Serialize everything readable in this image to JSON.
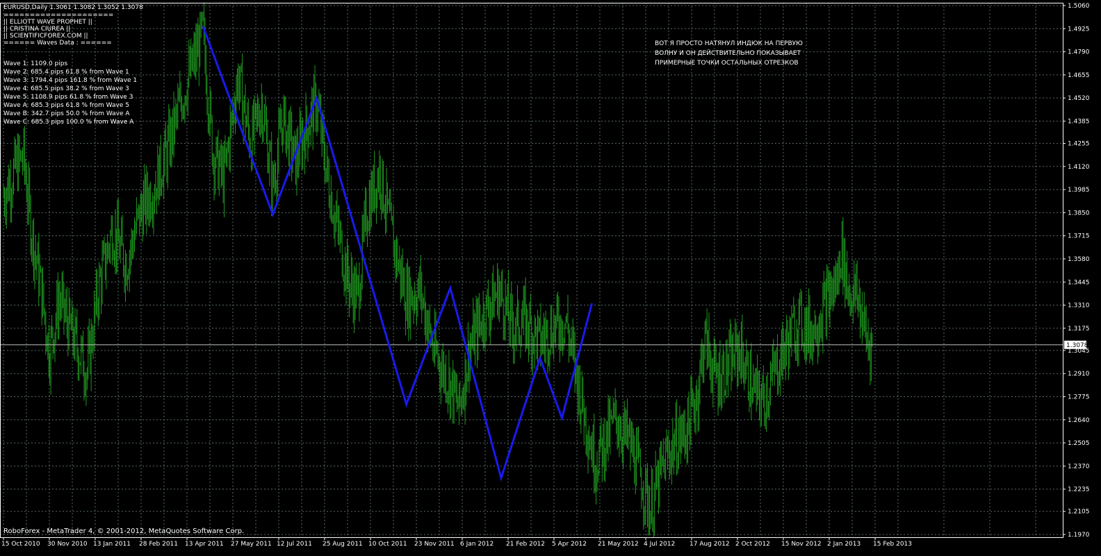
{
  "chart_header": "EURUSD,Daily  1.3061 1.3082 1.3052 1.3078",
  "indicator_box": [
    "=====================",
    "||   ELLIOTT WAVE PROPHET   ||",
    "||      CRISTINA CIUREA       ||",
    "||   SCIENTIFICFOREX.COM   ||",
    "====== Waves Data : ======"
  ],
  "wave_stats": [
    "Wave 1: 1109.0 pips",
    "Wave 2: 685.4 pips 61.8 % from Wave 1",
    "Wave 3: 1794.4 pips 161.8 % from Wave 1",
    "Wave 4: 685.5 pips 38.2 % from Wave 3",
    "Wave 5: 1108.9 pips 61.8 % from Wave 3",
    "Wave A: 685.3 pips 61.8 % from Wave 5",
    "Wave B: 342.7 pips 50.0 % from Wave A",
    "Wave C: 685.3 pips 100.0 % from Wave A"
  ],
  "comment_lines": [
    "ВОТ Я ПРОСТО НАТЯНУЛ ИНДЮК НА ПЕРВУЮ",
    "ВОЛНУ И ОН ДЕЙСТВИТЕЛЬНО ПОКАЗЫВАЕТ",
    "ПРИМЕРНЫЕ ТОЧКИ ОСТАЛЬНЫХ  ОТРЕЗКОВ"
  ],
  "footer_text": "RoboForex - MetaTrader 4, © 2001-2012, MetaQuotes Software Corp.",
  "current_price_label": "1.3078",
  "colors": {
    "background": "#000000",
    "grid": "#5a6a6a",
    "candles": "#1f9a1f",
    "wave": "#1a1aee",
    "text": "#ffffff",
    "price_line": "#c0c0c0",
    "axis": "#ffffff"
  },
  "chart_data": {
    "type": "line",
    "instrument": "EURUSD",
    "timeframe": "Daily",
    "last_ohlc": {
      "open": 1.3061,
      "high": 1.3082,
      "low": 1.3052,
      "close": 1.3078
    },
    "y_ticks": [
      "1.5060",
      "1.4925",
      "1.4790",
      "1.4655",
      "1.4520",
      "1.4385",
      "1.4255",
      "1.4120",
      "1.3985",
      "1.3850",
      "1.3715",
      "1.3580",
      "1.3445",
      "1.3310",
      "1.3175",
      "1.3045",
      "1.2910",
      "1.2775",
      "1.2640",
      "1.2505",
      "1.2370",
      "1.2235",
      "1.2105",
      "1.1970"
    ],
    "x_ticks": [
      "15 Oct 2010",
      "30 Nov 2010",
      "13 Jan 2011",
      "28 Feb 2011",
      "13 Apr 2011",
      "27 May 2011",
      "12 Jul 2011",
      "25 Aug 2011",
      "10 Oct 2011",
      "23 Nov 2011",
      "6 Jan 2012",
      "21 Feb 2012",
      "5 Apr 2012",
      "21 May 2012",
      "4 Jul 2012",
      "17 Aug 2012",
      "2 Oct 2012",
      "15 Nov 2012",
      "2 Jan 2013",
      "15 Feb 2013"
    ],
    "ylim": [
      1.197,
      1.506
    ],
    "current_price": 1.3078,
    "price_path": [
      {
        "x": "2010-10-15",
        "y": 1.395
      },
      {
        "x": "2010-10-28",
        "y": 1.412
      },
      {
        "x": "2010-11-04",
        "y": 1.418
      },
      {
        "x": "2010-11-12",
        "y": 1.375
      },
      {
        "x": "2010-11-22",
        "y": 1.34
      },
      {
        "x": "2010-11-30",
        "y": 1.303
      },
      {
        "x": "2010-12-10",
        "y": 1.335
      },
      {
        "x": "2010-12-20",
        "y": 1.318
      },
      {
        "x": "2011-01-07",
        "y": 1.292
      },
      {
        "x": "2011-01-18",
        "y": 1.34
      },
      {
        "x": "2011-02-01",
        "y": 1.375
      },
      {
        "x": "2011-02-15",
        "y": 1.355
      },
      {
        "x": "2011-03-01",
        "y": 1.385
      },
      {
        "x": "2011-03-15",
        "y": 1.4
      },
      {
        "x": "2011-03-28",
        "y": 1.42
      },
      {
        "x": "2011-04-12",
        "y": 1.452
      },
      {
        "x": "2011-04-22",
        "y": 1.47
      },
      {
        "x": "2011-05-03",
        "y": 1.49
      },
      {
        "x": "2011-05-13",
        "y": 1.42
      },
      {
        "x": "2011-05-24",
        "y": 1.405
      },
      {
        "x": "2011-06-07",
        "y": 1.465
      },
      {
        "x": "2011-06-20",
        "y": 1.425
      },
      {
        "x": "2011-07-01",
        "y": 1.45
      },
      {
        "x": "2011-07-12",
        "y": 1.4
      },
      {
        "x": "2011-07-22",
        "y": 1.44
      },
      {
        "x": "2011-08-04",
        "y": 1.415
      },
      {
        "x": "2011-08-12",
        "y": 1.43
      },
      {
        "x": "2011-08-25",
        "y": 1.45
      },
      {
        "x": "2011-09-05",
        "y": 1.405
      },
      {
        "x": "2011-09-15",
        "y": 1.375
      },
      {
        "x": "2011-09-26",
        "y": 1.345
      },
      {
        "x": "2011-10-05",
        "y": 1.335
      },
      {
        "x": "2011-10-14",
        "y": 1.385
      },
      {
        "x": "2011-10-27",
        "y": 1.41
      },
      {
        "x": "2011-11-07",
        "y": 1.375
      },
      {
        "x": "2011-11-23",
        "y": 1.335
      },
      {
        "x": "2011-12-07",
        "y": 1.34
      },
      {
        "x": "2011-12-20",
        "y": 1.305
      },
      {
        "x": "2012-01-06",
        "y": 1.285
      },
      {
        "x": "2012-01-15",
        "y": 1.27
      },
      {
        "x": "2012-01-25",
        "y": 1.305
      },
      {
        "x": "2012-02-08",
        "y": 1.325
      },
      {
        "x": "2012-02-24",
        "y": 1.34
      },
      {
        "x": "2012-03-08",
        "y": 1.318
      },
      {
        "x": "2012-03-20",
        "y": 1.322
      },
      {
        "x": "2012-04-05",
        "y": 1.31
      },
      {
        "x": "2012-04-18",
        "y": 1.318
      },
      {
        "x": "2012-05-01",
        "y": 1.322
      },
      {
        "x": "2012-05-15",
        "y": 1.28
      },
      {
        "x": "2012-05-30",
        "y": 1.24
      },
      {
        "x": "2012-06-08",
        "y": 1.25
      },
      {
        "x": "2012-06-20",
        "y": 1.265
      },
      {
        "x": "2012-07-04",
        "y": 1.25
      },
      {
        "x": "2012-07-18",
        "y": 1.225
      },
      {
        "x": "2012-07-25",
        "y": 1.212
      },
      {
        "x": "2012-08-07",
        "y": 1.238
      },
      {
        "x": "2012-08-17",
        "y": 1.25
      },
      {
        "x": "2012-08-30",
        "y": 1.258
      },
      {
        "x": "2012-09-10",
        "y": 1.28
      },
      {
        "x": "2012-09-17",
        "y": 1.312
      },
      {
        "x": "2012-09-28",
        "y": 1.288
      },
      {
        "x": "2012-10-10",
        "y": 1.295
      },
      {
        "x": "2012-10-22",
        "y": 1.305
      },
      {
        "x": "2012-11-05",
        "y": 1.28
      },
      {
        "x": "2012-11-15",
        "y": 1.275
      },
      {
        "x": "2012-11-28",
        "y": 1.295
      },
      {
        "x": "2012-12-10",
        "y": 1.31
      },
      {
        "x": "2012-12-20",
        "y": 1.322
      },
      {
        "x": "2013-01-02",
        "y": 1.315
      },
      {
        "x": "2013-01-15",
        "y": 1.33
      },
      {
        "x": "2013-01-28",
        "y": 1.345
      },
      {
        "x": "2013-02-01",
        "y": 1.365
      },
      {
        "x": "2013-02-08",
        "y": 1.34
      },
      {
        "x": "2013-02-18",
        "y": 1.335
      },
      {
        "x": "2013-02-27",
        "y": 1.31
      },
      {
        "x": "2013-03-05",
        "y": 1.3078
      }
    ],
    "wave_path": [
      {
        "x": "2011-05-03",
        "y": 1.494
      },
      {
        "x": "2011-07-12",
        "y": 1.384
      },
      {
        "x": "2011-08-25",
        "y": 1.452
      },
      {
        "x": "2011-11-23",
        "y": 1.273
      },
      {
        "x": "2012-01-06",
        "y": 1.341
      },
      {
        "x": "2012-02-26",
        "y": 1.23
      },
      {
        "x": "2012-04-05",
        "y": 1.3
      },
      {
        "x": "2012-04-27",
        "y": 1.265
      },
      {
        "x": "2012-05-27",
        "y": 1.332
      }
    ]
  }
}
